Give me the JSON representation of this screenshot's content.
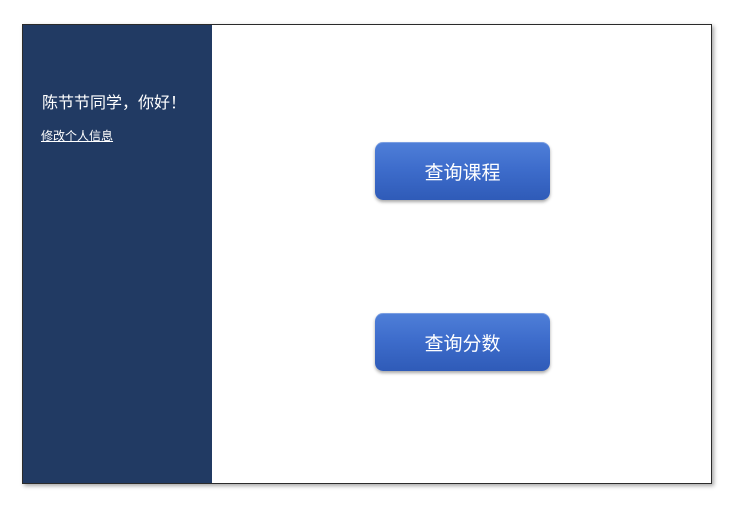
{
  "sidebar": {
    "greeting": "陈节节同学，你好！",
    "edit_profile_link": "修改个人信息"
  },
  "main": {
    "query_courses_label": "查询课程",
    "query_scores_label": "查询分数"
  },
  "colors": {
    "sidebar_bg": "#213a63",
    "button_bg": "#3e6dcc",
    "text_light": "#ffffff"
  }
}
